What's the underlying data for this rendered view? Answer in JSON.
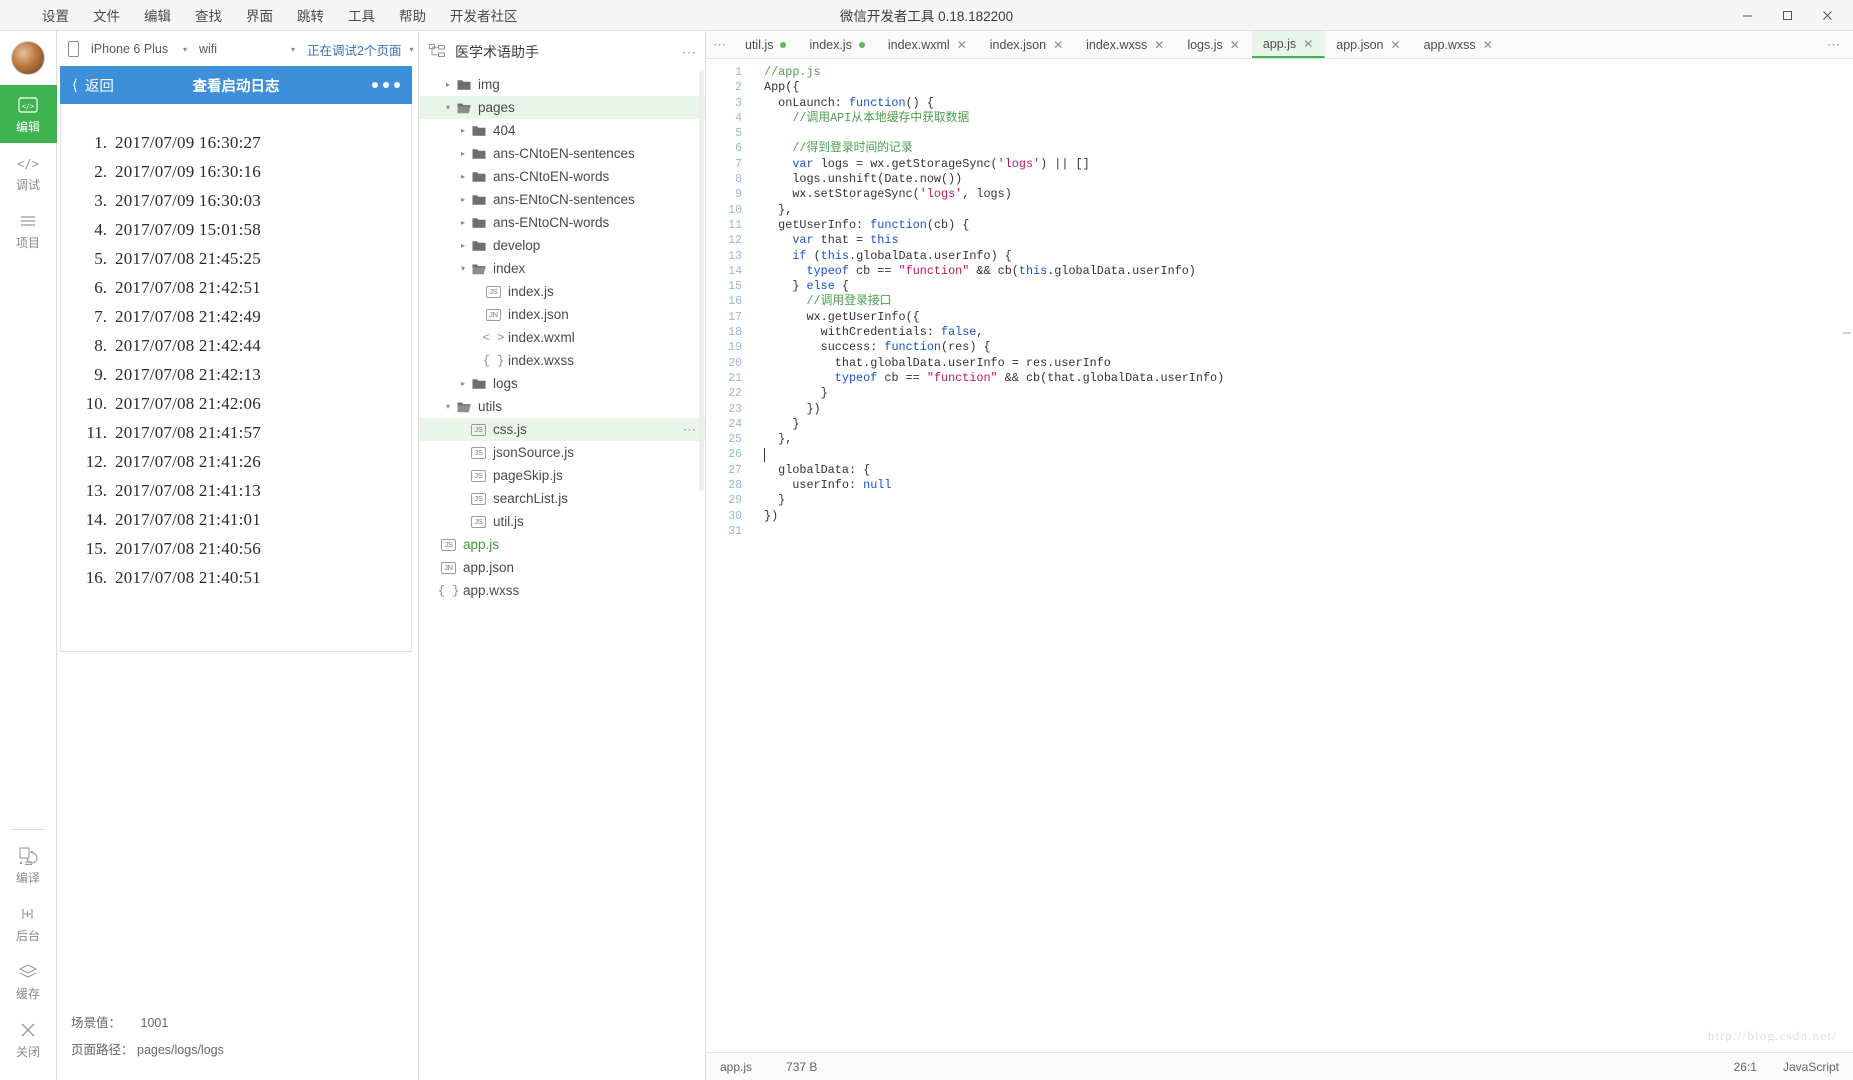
{
  "window": {
    "title": "微信开发者工具 0.18.182200",
    "controls": {
      "minimize": "—",
      "maximize": "▢",
      "close": "✕"
    }
  },
  "menubar": {
    "items": [
      {
        "label": "设置",
        "name": "menu-settings"
      },
      {
        "label": "文件",
        "name": "menu-file"
      },
      {
        "label": "编辑",
        "name": "menu-edit"
      },
      {
        "label": "查找",
        "name": "menu-find"
      },
      {
        "label": "界面",
        "name": "menu-ui"
      },
      {
        "label": "跳转",
        "name": "menu-goto"
      },
      {
        "label": "工具",
        "name": "menu-tools"
      },
      {
        "label": "帮助",
        "name": "menu-help"
      },
      {
        "label": "开发者社区",
        "name": "menu-community"
      }
    ]
  },
  "rail": {
    "items": [
      {
        "label": "编辑",
        "icon": "code-brackets-icon",
        "active": true
      },
      {
        "label": "调试",
        "icon": "debug-brackets-icon",
        "active": false
      },
      {
        "label": "项目",
        "icon": "list-lines-icon",
        "active": false
      }
    ],
    "bottom_items": [
      {
        "label": "编译",
        "icon": "compile-refresh-icon"
      },
      {
        "label": "后台",
        "icon": "background-icon"
      },
      {
        "label": "缓存",
        "icon": "cache-layers-icon"
      },
      {
        "label": "关闭",
        "icon": "close-x-icon"
      }
    ]
  },
  "simulator": {
    "toolbar": {
      "device_icon": "phone-icon",
      "device": "iPhone 6 Plus",
      "network": "wifi",
      "debug_status": "正在调试2个页面",
      "caret": "▾"
    },
    "nav": {
      "back_label": "返回",
      "back_icon": "chevron-left-icon",
      "title": "查看启动日志",
      "menu_icon": "more-dots-icon"
    },
    "logs": [
      {
        "index": "1.",
        "time": "2017/07/09 16:30:27"
      },
      {
        "index": "2.",
        "time": "2017/07/09 16:30:16"
      },
      {
        "index": "3.",
        "time": "2017/07/09 16:30:03"
      },
      {
        "index": "4.",
        "time": "2017/07/09 15:01:58"
      },
      {
        "index": "5.",
        "time": "2017/07/08 21:45:25"
      },
      {
        "index": "6.",
        "time": "2017/07/08 21:42:51"
      },
      {
        "index": "7.",
        "time": "2017/07/08 21:42:49"
      },
      {
        "index": "8.",
        "time": "2017/07/08 21:42:44"
      },
      {
        "index": "9.",
        "time": "2017/07/08 21:42:13"
      },
      {
        "index": "10.",
        "time": "2017/07/08 21:42:06"
      },
      {
        "index": "11.",
        "time": "2017/07/08 21:41:57"
      },
      {
        "index": "12.",
        "time": "2017/07/08 21:41:26"
      },
      {
        "index": "13.",
        "time": "2017/07/08 21:41:13"
      },
      {
        "index": "14.",
        "time": "2017/07/08 21:41:01"
      },
      {
        "index": "15.",
        "time": "2017/07/08 21:40:56"
      },
      {
        "index": "16.",
        "time": "2017/07/08 21:40:51"
      }
    ],
    "footer": {
      "scene_label": "场景值：",
      "scene_value": "1001",
      "path_label": "页面路径：",
      "path_value": "pages/logs/logs"
    }
  },
  "filetree": {
    "header": {
      "icon": "project-structure-icon",
      "project_name": "医学术语助手",
      "more": "⋯"
    },
    "nodes": [
      {
        "label": "img",
        "depth": 1,
        "type": "folder",
        "arrow": "▸",
        "selected": false
      },
      {
        "label": "pages",
        "depth": 1,
        "type": "folder-open",
        "arrow": "▾",
        "selected": true
      },
      {
        "label": "404",
        "depth": 2,
        "type": "folder",
        "arrow": "▸",
        "selected": false
      },
      {
        "label": "ans-CNtoEN-sentences",
        "depth": 2,
        "type": "folder",
        "arrow": "▸",
        "selected": false
      },
      {
        "label": "ans-CNtoEN-words",
        "depth": 2,
        "type": "folder",
        "arrow": "▸",
        "selected": false
      },
      {
        "label": "ans-ENtoCN-sentences",
        "depth": 2,
        "type": "folder",
        "arrow": "▸",
        "selected": false
      },
      {
        "label": "ans-ENtoCN-words",
        "depth": 2,
        "type": "folder",
        "arrow": "▸",
        "selected": false
      },
      {
        "label": "develop",
        "depth": 2,
        "type": "folder",
        "arrow": "▸",
        "selected": false
      },
      {
        "label": "index",
        "depth": 2,
        "type": "folder-open",
        "arrow": "▾",
        "selected": false
      },
      {
        "label": "index.js",
        "depth": 3,
        "type": "js",
        "arrow": "",
        "selected": false
      },
      {
        "label": "index.json",
        "depth": 3,
        "type": "json",
        "arrow": "",
        "selected": false
      },
      {
        "label": "index.wxml",
        "depth": 3,
        "type": "wxml",
        "arrow": "",
        "selected": false
      },
      {
        "label": "index.wxss",
        "depth": 3,
        "type": "wxss",
        "arrow": "",
        "selected": false
      },
      {
        "label": "logs",
        "depth": 2,
        "type": "folder",
        "arrow": "▸",
        "selected": false
      },
      {
        "label": "utils",
        "depth": 1,
        "type": "folder-open",
        "arrow": "▾",
        "selected": false
      },
      {
        "label": "css.js",
        "depth": 2,
        "type": "js",
        "arrow": "",
        "selected": true,
        "more": "⋯"
      },
      {
        "label": "jsonSource.js",
        "depth": 2,
        "type": "js",
        "arrow": "",
        "selected": false
      },
      {
        "label": "pageSkip.js",
        "depth": 2,
        "type": "js",
        "arrow": "",
        "selected": false
      },
      {
        "label": "searchList.js",
        "depth": 2,
        "type": "js",
        "arrow": "",
        "selected": false
      },
      {
        "label": "util.js",
        "depth": 2,
        "type": "js",
        "arrow": "",
        "selected": false
      },
      {
        "label": "app.js",
        "depth": 0,
        "type": "js",
        "arrow": "",
        "selected": false,
        "active": true
      },
      {
        "label": "app.json",
        "depth": 0,
        "type": "json",
        "arrow": "",
        "selected": false
      },
      {
        "label": "app.wxss",
        "depth": 0,
        "type": "wxss",
        "arrow": "",
        "selected": false
      }
    ],
    "badges": {
      "js": "JS",
      "json": "JN",
      "wxml": "< >",
      "wxss": "{ }"
    }
  },
  "editor": {
    "tabs_more_icon": "⋯",
    "tabs_right_icon": "⋯",
    "tabs": [
      {
        "label": "util.js",
        "state": "modified",
        "marker": "●",
        "active": false
      },
      {
        "label": "index.js",
        "state": "modified",
        "marker": "●",
        "active": false
      },
      {
        "label": "index.wxml",
        "state": "saved",
        "marker": "✕",
        "active": false
      },
      {
        "label": "index.json",
        "state": "saved",
        "marker": "✕",
        "active": false
      },
      {
        "label": "index.wxss",
        "state": "saved",
        "marker": "✕",
        "active": false
      },
      {
        "label": "logs.js",
        "state": "saved",
        "marker": "✕",
        "active": false
      },
      {
        "label": "app.js",
        "state": "saved",
        "marker": "✕",
        "active": true
      },
      {
        "label": "app.json",
        "state": "saved",
        "marker": "✕",
        "active": false
      },
      {
        "label": "app.wxss",
        "state": "saved",
        "marker": "✕",
        "active": false
      }
    ],
    "line_count": 31,
    "code_lines": [
      [
        {
          "t": "//app.js",
          "c": "cm"
        }
      ],
      [
        {
          "t": "App({",
          "c": "pl"
        }
      ],
      [
        {
          "t": "  onLaunch: ",
          "c": "pl"
        },
        {
          "t": "function",
          "c": "kw"
        },
        {
          "t": "() {",
          "c": "pl"
        }
      ],
      [
        {
          "t": "    //调用API从本地缓存中获取数据",
          "c": "cm"
        }
      ],
      [
        {
          "t": "",
          "c": "pl"
        }
      ],
      [
        {
          "t": "    //得到登录时间的记录",
          "c": "cm"
        }
      ],
      [
        {
          "t": "    ",
          "c": "pl"
        },
        {
          "t": "var",
          "c": "kw"
        },
        {
          "t": " logs = wx.getStorageSync(",
          "c": "pl"
        },
        {
          "t": "'logs'",
          "c": "str"
        },
        {
          "t": ") || []",
          "c": "pl"
        }
      ],
      [
        {
          "t": "    logs.unshift(Date.now())",
          "c": "pl"
        }
      ],
      [
        {
          "t": "    wx.setStorageSync(",
          "c": "pl"
        },
        {
          "t": "'logs'",
          "c": "str"
        },
        {
          "t": ", logs)",
          "c": "pl"
        }
      ],
      [
        {
          "t": "  },",
          "c": "pl"
        }
      ],
      [
        {
          "t": "  getUserInfo: ",
          "c": "pl"
        },
        {
          "t": "function",
          "c": "kw"
        },
        {
          "t": "(cb) {",
          "c": "pl"
        }
      ],
      [
        {
          "t": "    ",
          "c": "pl"
        },
        {
          "t": "var",
          "c": "kw"
        },
        {
          "t": " that = ",
          "c": "pl"
        },
        {
          "t": "this",
          "c": "kw"
        }
      ],
      [
        {
          "t": "    ",
          "c": "pl"
        },
        {
          "t": "if",
          "c": "kw"
        },
        {
          "t": " (",
          "c": "pl"
        },
        {
          "t": "this",
          "c": "kw"
        },
        {
          "t": ".globalData.userInfo) {",
          "c": "pl"
        }
      ],
      [
        {
          "t": "      ",
          "c": "pl"
        },
        {
          "t": "typeof",
          "c": "kw"
        },
        {
          "t": " cb == ",
          "c": "pl"
        },
        {
          "t": "\"function\"",
          "c": "str"
        },
        {
          "t": " && cb(",
          "c": "pl"
        },
        {
          "t": "this",
          "c": "kw"
        },
        {
          "t": ".globalData.userInfo)",
          "c": "pl"
        }
      ],
      [
        {
          "t": "    } ",
          "c": "pl"
        },
        {
          "t": "else",
          "c": "kw"
        },
        {
          "t": " {",
          "c": "pl"
        }
      ],
      [
        {
          "t": "      //调用登录接口",
          "c": "cm"
        }
      ],
      [
        {
          "t": "      wx.getUserInfo({",
          "c": "pl"
        }
      ],
      [
        {
          "t": "        withCredentials: ",
          "c": "pl"
        },
        {
          "t": "false",
          "c": "kw"
        },
        {
          "t": ",",
          "c": "pl"
        }
      ],
      [
        {
          "t": "        success: ",
          "c": "pl"
        },
        {
          "t": "function",
          "c": "kw"
        },
        {
          "t": "(res) {",
          "c": "pl"
        }
      ],
      [
        {
          "t": "          that.globalData.userInfo = res.userInfo",
          "c": "pl"
        }
      ],
      [
        {
          "t": "          ",
          "c": "pl"
        },
        {
          "t": "typeof",
          "c": "kw"
        },
        {
          "t": " cb == ",
          "c": "pl"
        },
        {
          "t": "\"function\"",
          "c": "str"
        },
        {
          "t": " && cb(that.globalData.userInfo)",
          "c": "pl"
        }
      ],
      [
        {
          "t": "        }",
          "c": "pl"
        }
      ],
      [
        {
          "t": "      })",
          "c": "pl"
        }
      ],
      [
        {
          "t": "    }",
          "c": "pl"
        }
      ],
      [
        {
          "t": "  },",
          "c": "pl"
        }
      ],
      [
        {
          "t": "",
          "c": "pl"
        }
      ],
      [
        {
          "t": "  globalData: {",
          "c": "pl"
        }
      ],
      [
        {
          "t": "    userInfo: ",
          "c": "pl"
        },
        {
          "t": "null",
          "c": "kw"
        }
      ],
      [
        {
          "t": "  }",
          "c": "pl"
        }
      ],
      [
        {
          "t": "})",
          "c": "pl"
        }
      ],
      [
        {
          "t": "",
          "c": "pl"
        }
      ]
    ],
    "watermark": "http://blog.csdn.net/"
  },
  "statusbar": {
    "file": "app.js",
    "size": "737 B",
    "cursor": "26:1",
    "language": "JavaScript"
  }
}
